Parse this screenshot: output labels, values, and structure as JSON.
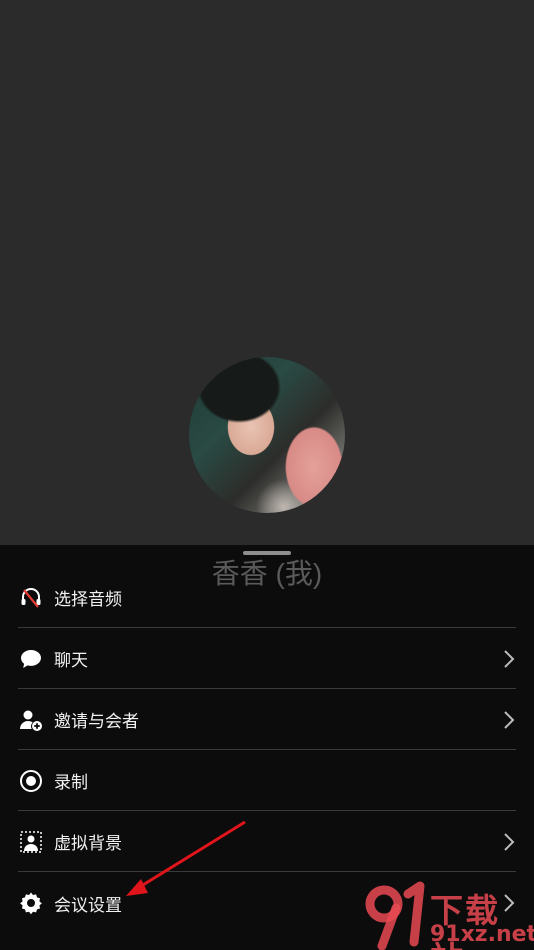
{
  "participant": {
    "name": "香香 (我)"
  },
  "menu": {
    "items": [
      {
        "label": "选择音频",
        "icon": "headset-muted-icon",
        "has_chevron": false
      },
      {
        "label": "聊天",
        "icon": "chat-bubble-icon",
        "has_chevron": true
      },
      {
        "label": "邀请与会者",
        "icon": "add-person-icon",
        "has_chevron": true
      },
      {
        "label": "录制",
        "icon": "record-icon",
        "has_chevron": false
      },
      {
        "label": "虚拟背景",
        "icon": "virtual-background-icon",
        "has_chevron": true
      },
      {
        "label": "会议设置",
        "icon": "gear-icon",
        "has_chevron": true
      }
    ]
  },
  "watermark": {
    "brand_cn": "下载站",
    "brand_url": "91xz.net",
    "logo": "91-logo"
  },
  "colors": {
    "background": "#2b2b2b",
    "sheet": "#0c0c0c",
    "divider": "#3a3a3a",
    "muted_red": "#e53935",
    "annotation_arrow": "#e0151b"
  }
}
